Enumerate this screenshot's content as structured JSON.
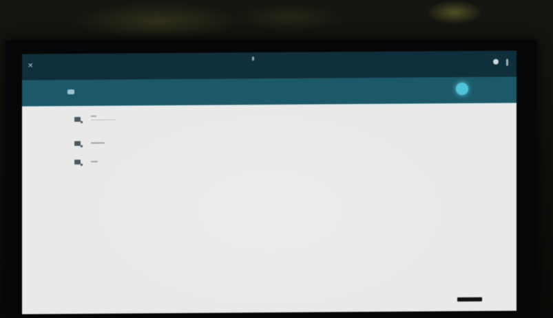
{
  "app": {
    "title": "",
    "nav_icon": "back-icon",
    "overflow_icon": "more-vert-icon"
  },
  "search": {
    "icon": "search-icon",
    "fab_icon": "add-icon"
  },
  "list": {
    "items": [
      {
        "icon": "item-icon",
        "primary": "",
        "secondary": ""
      },
      {
        "icon": "item-icon",
        "primary": "",
        "secondary": ""
      },
      {
        "icon": "item-icon",
        "primary": "",
        "secondary": ""
      }
    ]
  },
  "colors": {
    "app_bar": "#0e2f3b",
    "search_bar": "#1b5968",
    "fab": "#4fc3d8",
    "content_bg": "#e9e9ea"
  }
}
